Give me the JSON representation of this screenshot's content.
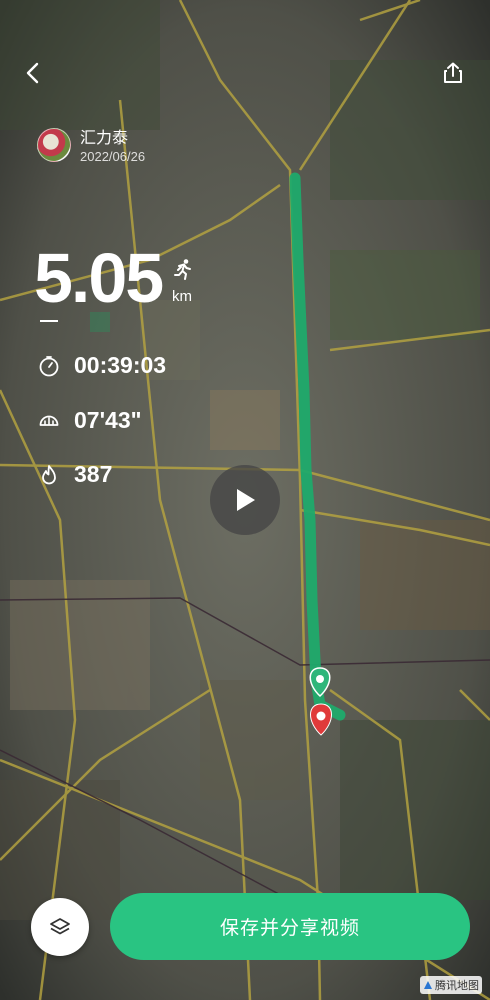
{
  "user": {
    "name": "汇力泰",
    "date": "2022/06/26"
  },
  "run": {
    "distance": "5.05",
    "unit": "km",
    "duration": "00:39:03",
    "pace": "07'43\"",
    "calories": "387"
  },
  "actions": {
    "save_share_label": "保存并分享视频"
  },
  "map": {
    "watermark": "腾讯地图"
  },
  "colors": {
    "accent": "#29c482",
    "route": "#1faa6c",
    "end_pin": "#e03a3a",
    "start_pin": "#2eb67a"
  },
  "icons": {
    "back": "chevron-left-icon",
    "share": "share-icon",
    "run_type": "running-person-icon",
    "duration": "stopwatch-icon",
    "pace": "speedometer-icon",
    "calories": "flame-icon",
    "play": "play-icon",
    "layers": "layers-icon"
  }
}
